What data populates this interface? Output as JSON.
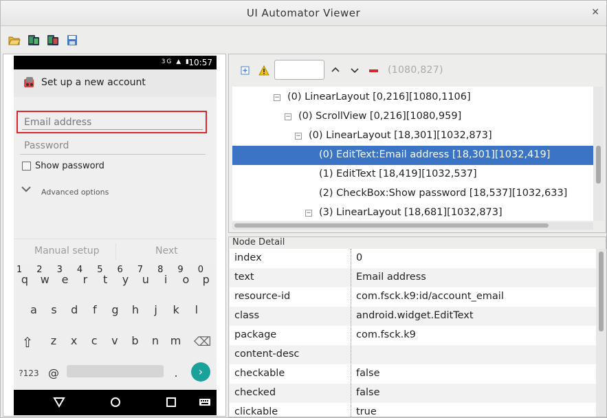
{
  "window": {
    "title": "UI Automator Viewer",
    "close_glyph": "✕"
  },
  "toolbar": {
    "open_icon": "folder-open-icon",
    "screenshot_icon": "device-screenshot-icon",
    "screenshot_compressed_icon": "device-screenshot-compressed-icon",
    "save_icon": "save-icon"
  },
  "phone": {
    "status": {
      "icons": "3G ▲ ▮",
      "time": "10:57"
    },
    "app_title": "Set up a new account",
    "email_placeholder": "Email address",
    "password_placeholder": "Password",
    "show_password_label": "Show password",
    "advanced_label": "Advanced options",
    "manual_setup_label": "Manual setup",
    "next_label": "Next",
    "keyboard": {
      "row1": [
        "q",
        "w",
        "e",
        "r",
        "t",
        "y",
        "u",
        "i",
        "o",
        "p"
      ],
      "row1_hints": [
        "1",
        "2",
        "3",
        "4",
        "5",
        "6",
        "7",
        "8",
        "9",
        "0"
      ],
      "row2": [
        "a",
        "s",
        "d",
        "f",
        "g",
        "h",
        "j",
        "k",
        "l"
      ],
      "row3": [
        "z",
        "x",
        "c",
        "v",
        "b",
        "n",
        "m"
      ],
      "symbols_label": "?123",
      "at_label": "@",
      "dot_label": ".",
      "enter_glyph": "›",
      "shift_glyph": "⇧",
      "backspace_glyph": "⌫"
    },
    "nav": [
      "back-triangle-icon",
      "home-circle-icon",
      "recents-square-icon",
      "keyboard-icon"
    ]
  },
  "tree_toolbar": {
    "expand_icon": "expand-all-icon",
    "warning_icon": "warning-icon",
    "search_value": "",
    "up_glyph": "⌃",
    "down_glyph": "⌄",
    "clear_icon": "clear-red-dash-icon",
    "coords": "(1080,827)"
  },
  "tree": {
    "rows": [
      {
        "text": "(0) LinearLayout [0,216][1080,1106]",
        "expander": "−",
        "selected": false
      },
      {
        "text": "(0) ScrollView [0,216][1080,959]",
        "expander": "−",
        "selected": false
      },
      {
        "text": "(0) LinearLayout [18,301][1032,873]",
        "expander": "−",
        "selected": false
      },
      {
        "text": "(0) EditText:Email address [18,301][1032,419]",
        "expander": "",
        "selected": true
      },
      {
        "text": "(1) EditText [18,419][1032,537]",
        "expander": "",
        "selected": false
      },
      {
        "text": "(2) CheckBox:Show password [18,537][1032,633]",
        "expander": "",
        "selected": false
      },
      {
        "text": "(3) LinearLayout [18,681][1032,873]",
        "expander": "−",
        "selected": false
      }
    ]
  },
  "detail": {
    "title": "Node Detail",
    "rows": [
      {
        "key": "index",
        "value": "0"
      },
      {
        "key": "text",
        "value": "Email address"
      },
      {
        "key": "resource-id",
        "value": "com.fsck.k9:id/account_email"
      },
      {
        "key": "class",
        "value": "android.widget.EditText"
      },
      {
        "key": "package",
        "value": "com.fsck.k9"
      },
      {
        "key": "content-desc",
        "value": ""
      },
      {
        "key": "checkable",
        "value": "false"
      },
      {
        "key": "checked",
        "value": "false"
      },
      {
        "key": "clickable",
        "value": "true"
      }
    ]
  },
  "colors": {
    "selection": "#3b74c5",
    "highlight_border": "#d8262b",
    "enter_key": "#1aa29a"
  }
}
